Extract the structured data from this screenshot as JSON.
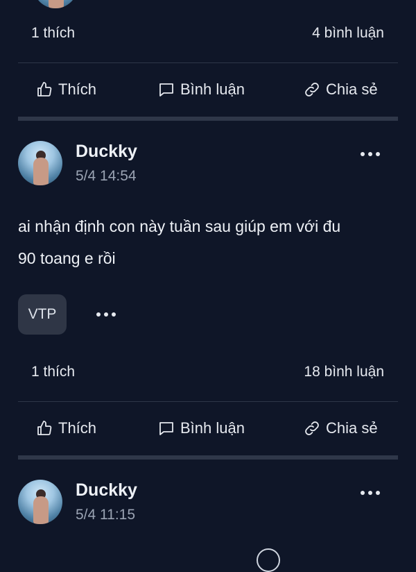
{
  "post_top": {
    "likes": "1 thích",
    "comments": "4 bình luận"
  },
  "actions": {
    "like": "Thích",
    "comment": "Bình luận",
    "share": "Chia sẻ"
  },
  "post1": {
    "author": "Duckky",
    "time": "5/4 14:54",
    "content_line1": "ai nhận định con này tuần sau giúp em với đu",
    "content_line2": "90 toang e rồi",
    "ticker": "VTP",
    "likes": "1 thích",
    "comments": "18 bình luận"
  },
  "post2": {
    "author": "Duckky",
    "time": "5/4 11:15"
  },
  "colors": {
    "background": "#0f1628",
    "text": "#e9ecf2",
    "muted": "#9aa3b3",
    "tag_bg": "#2f3646"
  }
}
